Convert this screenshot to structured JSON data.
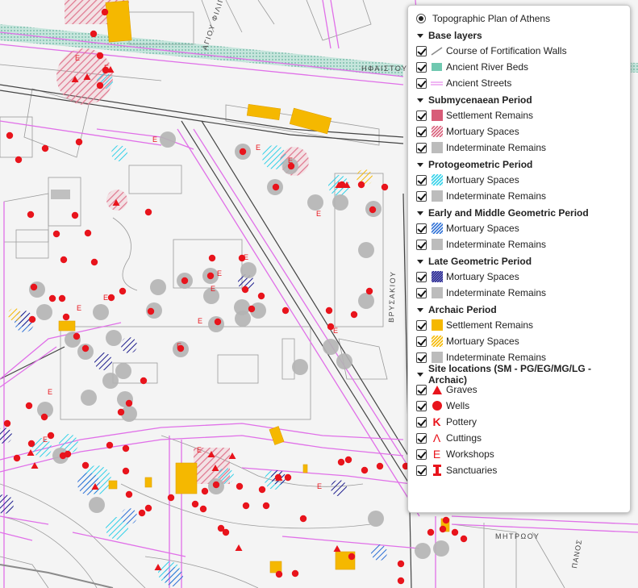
{
  "basemap": {
    "radio_label": "Topographic Plan of Athens",
    "selected": true
  },
  "groups": [
    {
      "title": "Base layers",
      "layers": [
        {
          "label": "Course of Fortification Walls",
          "icon": "wall-line-icon",
          "checked": true
        },
        {
          "label": "Ancient River Beds",
          "icon": "river-bed-icon",
          "checked": true
        },
        {
          "label": "Ancient Streets",
          "icon": "street-line-icon",
          "checked": true
        }
      ]
    },
    {
      "title": "Submycenaean Period",
      "layers": [
        {
          "label": "Settlement Remains",
          "icon": "settlement-swatch-icon",
          "checked": true
        },
        {
          "label": "Mortuary Spaces",
          "icon": "mortuary-hatch-icon",
          "checked": true
        },
        {
          "label": "Indeterminate Remains",
          "icon": "indeterminate-swatch-icon",
          "checked": true
        }
      ]
    },
    {
      "title": "Protogeometric Period",
      "layers": [
        {
          "label": "Mortuary Spaces",
          "icon": "mortuary-hatch-icon",
          "checked": true
        },
        {
          "label": "Indeterminate Remains",
          "icon": "indeterminate-swatch-icon",
          "checked": true
        }
      ]
    },
    {
      "title": "Early and Middle Geometric Period",
      "layers": [
        {
          "label": "Mortuary Spaces",
          "icon": "mortuary-hatch-icon",
          "checked": true
        },
        {
          "label": "Indeterminate Remains",
          "icon": "indeterminate-swatch-icon",
          "checked": true
        }
      ]
    },
    {
      "title": "Late Geometric Period",
      "layers": [
        {
          "label": "Mortuary Spaces",
          "icon": "mortuary-hatch-icon",
          "checked": true
        },
        {
          "label": "Indeterminate Remains",
          "icon": "indeterminate-swatch-icon",
          "checked": true
        }
      ]
    },
    {
      "title": "Archaic Period",
      "layers": [
        {
          "label": "Settlement Remains",
          "icon": "settlement-swatch-icon",
          "checked": true
        },
        {
          "label": "Mortuary Spaces",
          "icon": "mortuary-hatch-icon",
          "checked": true
        },
        {
          "label": "Indeterminate Remains",
          "icon": "indeterminate-swatch-icon",
          "checked": true
        }
      ]
    },
    {
      "title": "Site locations (SM - PG/EG/MG/LG - Archaic)",
      "layers": [
        {
          "label": "Graves",
          "icon": "grave-triangle-icon",
          "checked": true
        },
        {
          "label": "Wells",
          "icon": "well-dot-icon",
          "checked": true
        },
        {
          "label": "Pottery",
          "icon": "pottery-k-icon",
          "checked": true
        },
        {
          "label": "Cuttings",
          "icon": "cutting-lambda-icon",
          "checked": true
        },
        {
          "label": "Workshops",
          "icon": "workshop-e-icon",
          "checked": true
        },
        {
          "label": "Sanctuaries",
          "icon": "sanctuary-i-icon",
          "checked": true
        }
      ]
    }
  ],
  "map_labels": {
    "street_1": "ΑΓΙΟΥ ΦΙΛΙΠΠ",
    "street_2": "ΗΦΑΙΣΤΟΥ",
    "street_3": "ΒΡΥΣΑΚΙΟΥ",
    "street_4": "ΜΗΤΡΩΟΥ",
    "street_5": "ΠΑΝΟΣ"
  },
  "colors": {
    "street_magenta": "#e070e8",
    "river_teal": "#6fc8b0",
    "red_marker": "#e8141c",
    "gray_marker": "#b4b4b4",
    "orange_settlement": "#f5b800",
    "pink_mortuary": "#d85c78",
    "cyan_mortuary": "#2fd0e8",
    "blue_mortuary": "#2b6fd6",
    "navy_mortuary": "#1a1a8c"
  },
  "markers": {
    "grave_E_positions_hint": "map"
  }
}
